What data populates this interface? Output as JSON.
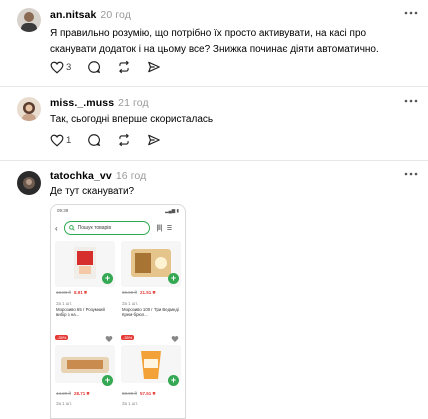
{
  "posts": [
    {
      "username": "an.nitsak",
      "time": "20 год",
      "text": "Я правильно розумію, що потрібно їх просто активувати, на касі про сканувати додаток і на цьому все? Знижка починає діяти автоматично.",
      "likes": "3"
    },
    {
      "username": "miss._.muss",
      "time": "21 год",
      "text": "Так, сьогодні вперше скористалась",
      "likes": "1"
    },
    {
      "username": "tatochka_vv",
      "time": "16 год",
      "text": "Де тут сканувати?"
    }
  ],
  "screenshot": {
    "status_time": "09:39",
    "search_placeholder": "Пошук товарів",
    "products": [
      {
        "qty": "За 1 шт.",
        "old_price": "13.89 ₴",
        "new_price": "8.91 ₴",
        "name": "Морозиво 65 г Розумний вибір з на..."
      },
      {
        "qty": "За 1 шт.",
        "old_price": "30.99 ₴",
        "new_price": "21.51 ₴",
        "name": "Морозиво 100 г Три Ведмеді Крем-брюл..."
      },
      {
        "qty": "За 1 шт.",
        "old_price": "44.29 ₴",
        "new_price": "28.71 ₴",
        "sale": "-35%"
      },
      {
        "qty": "За 1 шт.",
        "old_price": "88.99 ₴",
        "new_price": "57.51 ₴",
        "sale": "-35%"
      }
    ]
  },
  "colors": {
    "accent_green": "#34a853",
    "sale_red": "#e53935"
  }
}
